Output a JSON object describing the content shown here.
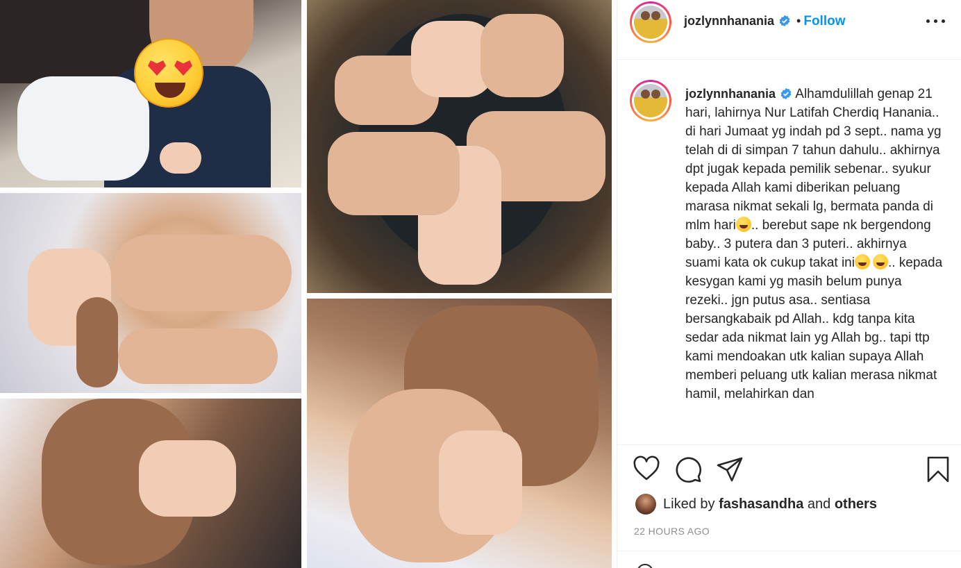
{
  "post": {
    "username": "jozlynnhanania",
    "verified": true,
    "separator": "•",
    "follow_label": "Follow",
    "caption_username": "jozlynnhanania",
    "caption_parts": [
      "Alhamdulillah genap 21 hari, lahirnya Nur Latifah Cherdiq Hanania.. di hari Jumaat yg indah pd 3 sept.. nama yg telah di di simpan 7 tahun dahulu.. akhirnya dpt jugak kepada pemilik sebenar.. syukur kepada Allah kami diberikan peluang marasa nikmat sekali lg, bermata panda di mlm hari",
      ".. berebut sape nk bergendong baby.. 3 putera dan 3 puteri.. akhirnya suami kata ok cukup takat ini",
      ".. kepada kesygan kami yg masih belum punya rezeki.. jgn putus asa.. sentiasa bersangkabaik pd Allah.. kdg tanpa kita sedar ada nikmat lain yg Allah bg.. tapi ttp kami mendoakan utk kalian supaya Allah memberi peluang utk kalian merasa nikmat hamil, melahirkan dan"
    ],
    "liked_by_prefix": "Liked by",
    "liked_by_user": "fashasandha",
    "liked_by_and": "and",
    "liked_by_others": "others",
    "timestamp": "22 HOURS AGO"
  },
  "icons": {
    "verified": "verified-badge-icon",
    "more": "more-options-icon",
    "like": "heart-icon",
    "comment": "comment-icon",
    "share": "paper-plane-icon",
    "save": "bookmark-icon"
  },
  "colors": {
    "accent": "#0095f6",
    "text": "#262626",
    "muted": "#8e8e8e",
    "border": "#efefef"
  }
}
